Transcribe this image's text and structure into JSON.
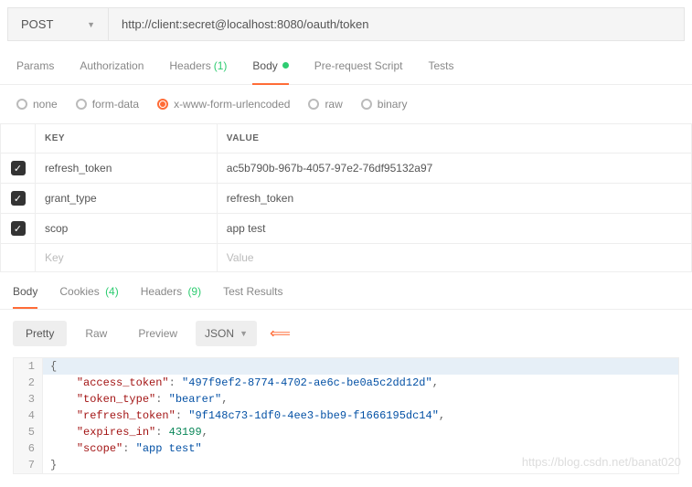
{
  "request": {
    "method": "POST",
    "url": "http://client:secret@localhost:8080/oauth/token"
  },
  "req_tabs": {
    "params": "Params",
    "auth": "Authorization",
    "headers_label": "Headers",
    "headers_count": "(1)",
    "body": "Body",
    "prereq": "Pre-request Script",
    "tests": "Tests"
  },
  "body_types": {
    "none": "none",
    "formdata": "form-data",
    "xwww": "x-www-form-urlencoded",
    "raw": "raw",
    "binary": "binary"
  },
  "table": {
    "key_header": "KEY",
    "value_header": "VALUE",
    "rows": [
      {
        "key": "refresh_token",
        "value": "ac5b790b-967b-4057-97e2-76df95132a97"
      },
      {
        "key": "grant_type",
        "value": "refresh_token"
      },
      {
        "key": "scop",
        "value": "app test"
      }
    ],
    "key_ph": "Key",
    "value_ph": "Value"
  },
  "resp_tabs": {
    "body": "Body",
    "cookies_label": "Cookies",
    "cookies_count": "(4)",
    "headers_label": "Headers",
    "headers_count": "(9)",
    "tests": "Test Results"
  },
  "toolbar": {
    "pretty": "Pretty",
    "raw": "Raw",
    "preview": "Preview",
    "format": "JSON"
  },
  "response": {
    "access_token_k": "\"access_token\"",
    "access_token_v": "\"497f9ef2-8774-4702-ae6c-be0a5c2dd12d\"",
    "token_type_k": "\"token_type\"",
    "token_type_v": "\"bearer\"",
    "refresh_token_k": "\"refresh_token\"",
    "refresh_token_v": "\"9f148c73-1df0-4ee3-bbe9-f1666195dc14\"",
    "expires_in_k": "\"expires_in\"",
    "expires_in_v": "43199",
    "scope_k": "\"scope\"",
    "scope_v": "\"app test\""
  },
  "watermark": "https://blog.csdn.net/banat020",
  "chart_data": {
    "type": "table",
    "title": "OAuth token response",
    "rows": [
      {
        "field": "access_token",
        "value": "497f9ef2-8774-4702-ae6c-be0a5c2dd12d"
      },
      {
        "field": "token_type",
        "value": "bearer"
      },
      {
        "field": "refresh_token",
        "value": "9f148c73-1df0-4ee3-bbe9-f1666195dc14"
      },
      {
        "field": "expires_in",
        "value": 43199
      },
      {
        "field": "scope",
        "value": "app test"
      }
    ]
  }
}
